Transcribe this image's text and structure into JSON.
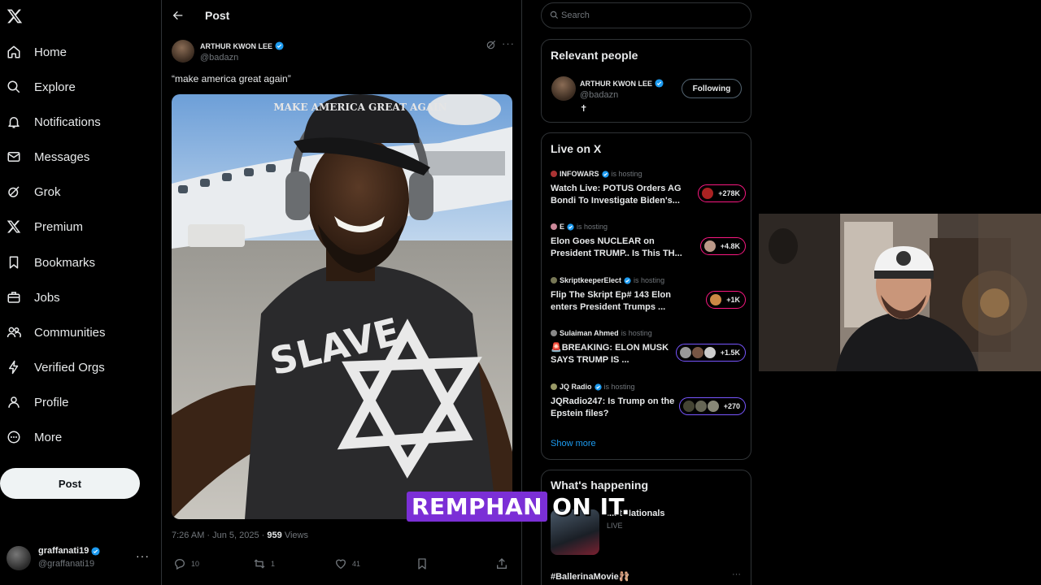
{
  "nav": {
    "items": [
      {
        "label": "Home",
        "icon": "home-icon"
      },
      {
        "label": "Explore",
        "icon": "search-icon"
      },
      {
        "label": "Notifications",
        "icon": "bell-icon"
      },
      {
        "label": "Messages",
        "icon": "mail-icon"
      },
      {
        "label": "Grok",
        "icon": "grok-icon"
      },
      {
        "label": "Premium",
        "icon": "x-logo-icon"
      },
      {
        "label": "Bookmarks",
        "icon": "bookmark-icon"
      },
      {
        "label": "Jobs",
        "icon": "briefcase-icon"
      },
      {
        "label": "Communities",
        "icon": "people-icon"
      },
      {
        "label": "Verified Orgs",
        "icon": "lightning-icon"
      },
      {
        "label": "Profile",
        "icon": "person-icon"
      },
      {
        "label": "More",
        "icon": "more-circle-icon"
      }
    ],
    "post_button": "Post",
    "account": {
      "name": "graffanati19",
      "handle": "@graffanati19"
    }
  },
  "header": {
    "title": "Post"
  },
  "post": {
    "author_name": "ARTHUR KWON LEE",
    "author_handle": "@badazn",
    "text": "“make america great again”",
    "image_hat_text": "MAKE AMERICA GREAT AGAIN",
    "image_shirt_text": "SLAVE",
    "timestamp": "7:26 AM · Jun 5, 2025 · ",
    "views_count": "959",
    "views_label": " Views",
    "replies": "10",
    "reposts": "1",
    "likes": "41"
  },
  "search": {
    "placeholder": "Search"
  },
  "relevant_people": {
    "title": "Relevant people",
    "name": "ARTHUR KWON LEE",
    "handle": "@badazn",
    "bio": "✝",
    "button": "Following"
  },
  "live": {
    "title": "Live on X",
    "items": [
      {
        "host": "INFOWARS",
        "status": "is hosting",
        "title": "Watch Live: POTUS Orders AG Bondi To Investigate Biden's...",
        "count": "+278K",
        "color": "#f91880"
      },
      {
        "host": "E",
        "status": "is hosting",
        "title": "Elon Goes NUCLEAR on President TRUMP.. Is This TH...",
        "count": "+4.8K",
        "color": "#f91880"
      },
      {
        "host": "SkriptkeeperElect",
        "status": "is hosting",
        "title": "Flip The Skript Ep# 143 Elon enters President Trumps ...",
        "count": "+1K",
        "color": "#f91880"
      },
      {
        "host": "Sulaiman Ahmed",
        "status": "is hosting",
        "title": "🚨BREAKING: ELON MUSK SAYS TRUMP IS ...",
        "count": "+1.5K",
        "color": "#7856ff"
      },
      {
        "host": "JQ Radio",
        "status": "is hosting",
        "title": "JQRadio247: Is Trump on the Epstein files?",
        "count": "+270",
        "color": "#7856ff"
      }
    ],
    "show_more": "Show more"
  },
  "happening": {
    "title": "What's happening",
    "trend_text": "...at Nationals",
    "trend_status": "LIVE",
    "hashtag": "#BallerinaMovie🩰",
    "more": "···"
  },
  "caption": {
    "highlight": "REMPHAN",
    "rest": "ON IT."
  },
  "colors": {
    "accent": "#1d9bf0",
    "live_pink": "#f91880",
    "live_purple": "#7856ff",
    "caption_bg": "#7b2fd6"
  }
}
